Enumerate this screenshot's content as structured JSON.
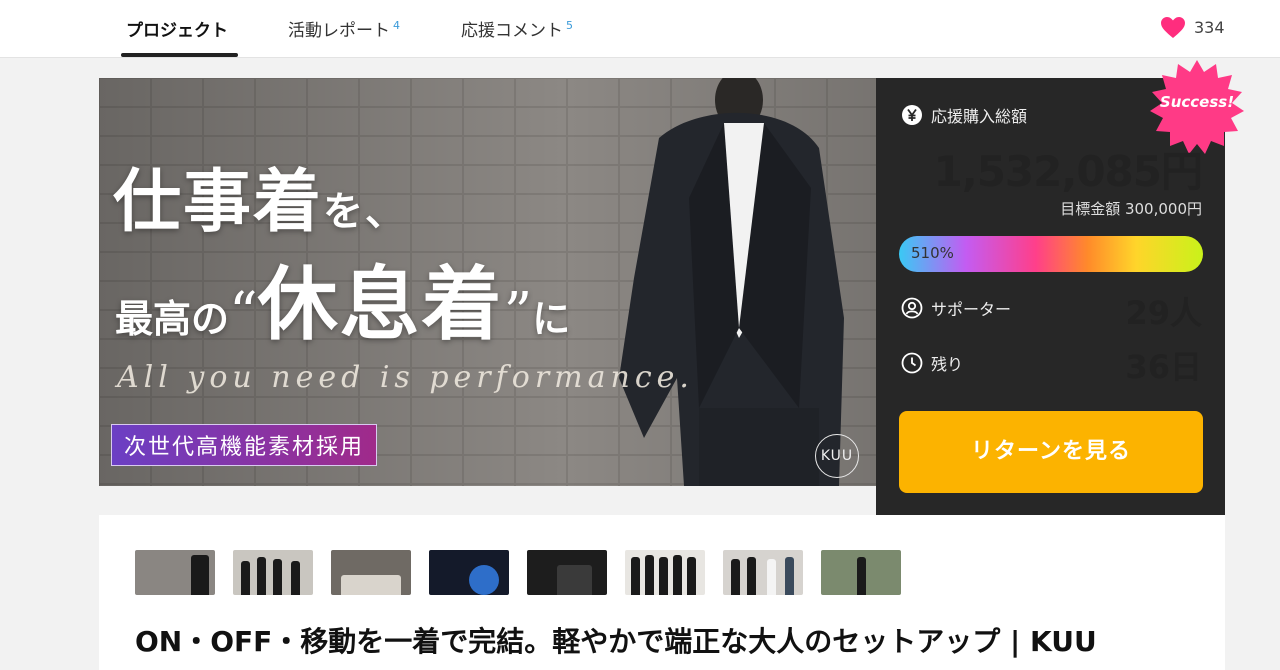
{
  "tabs": [
    {
      "label": "プロジェクト",
      "count": ""
    },
    {
      "label": "活動レポート",
      "count": "4"
    },
    {
      "label": "応援コメント",
      "count": "5"
    }
  ],
  "favorite": {
    "icon": "heart-icon",
    "count": "334",
    "color": "#ff2d7e"
  },
  "hero": {
    "headline_1a": "仕事着",
    "headline_1b": "を、",
    "headline_2a": "最高の",
    "headline_2b_open": "“",
    "headline_2b": "休息着",
    "headline_2b_close": "”",
    "headline_2c": "に",
    "subline": "All you need is performance.",
    "tag": "次世代高機能素材採用",
    "logo": "KUU"
  },
  "panel": {
    "badge": "Success!",
    "total_label": "応援購入総額",
    "total_amount": "1,532,085円",
    "goal": "目標金額 300,000円",
    "progress_label": "510%",
    "progress_percent": 510,
    "supporters_label": "サポーター",
    "supporters_value": "29人",
    "remaining_label": "残り",
    "remaining_value": "36日",
    "return_button": "リターンを見る",
    "accent_color": "#fcb300"
  },
  "project_title": "ON・OFF・移動を一着で完結。軽やかで端正な大人のセットアップ | KUU"
}
